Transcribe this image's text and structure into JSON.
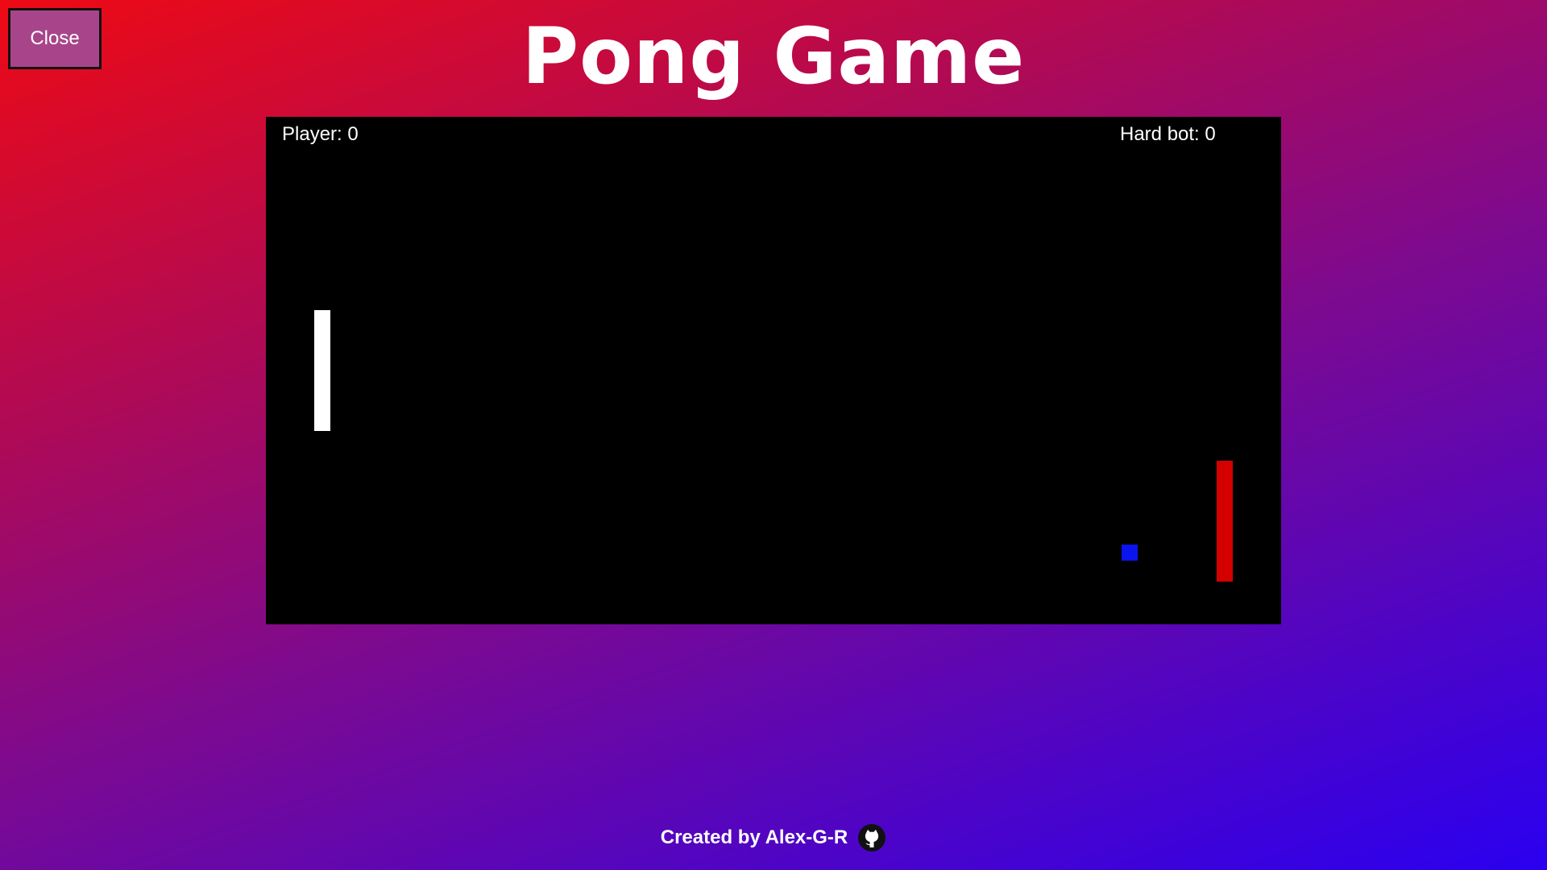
{
  "header": {
    "close_label": "Close",
    "title": "Pong Game"
  },
  "game": {
    "player_score_text": "Player: 0",
    "bot_score_text": "Hard bot: 0",
    "player_score": 0,
    "bot_score": 0,
    "colors": {
      "board": "#000000",
      "player_paddle": "#ffffff",
      "bot_paddle": "#d40000",
      "ball": "#0a14ee"
    }
  },
  "footer": {
    "credit_text": "Created by Alex-G-R",
    "icon": "github-icon"
  },
  "colors": {
    "close_button": "#a8458a",
    "gradient_start": "#ee0a14",
    "gradient_end": "#2a00f0"
  }
}
